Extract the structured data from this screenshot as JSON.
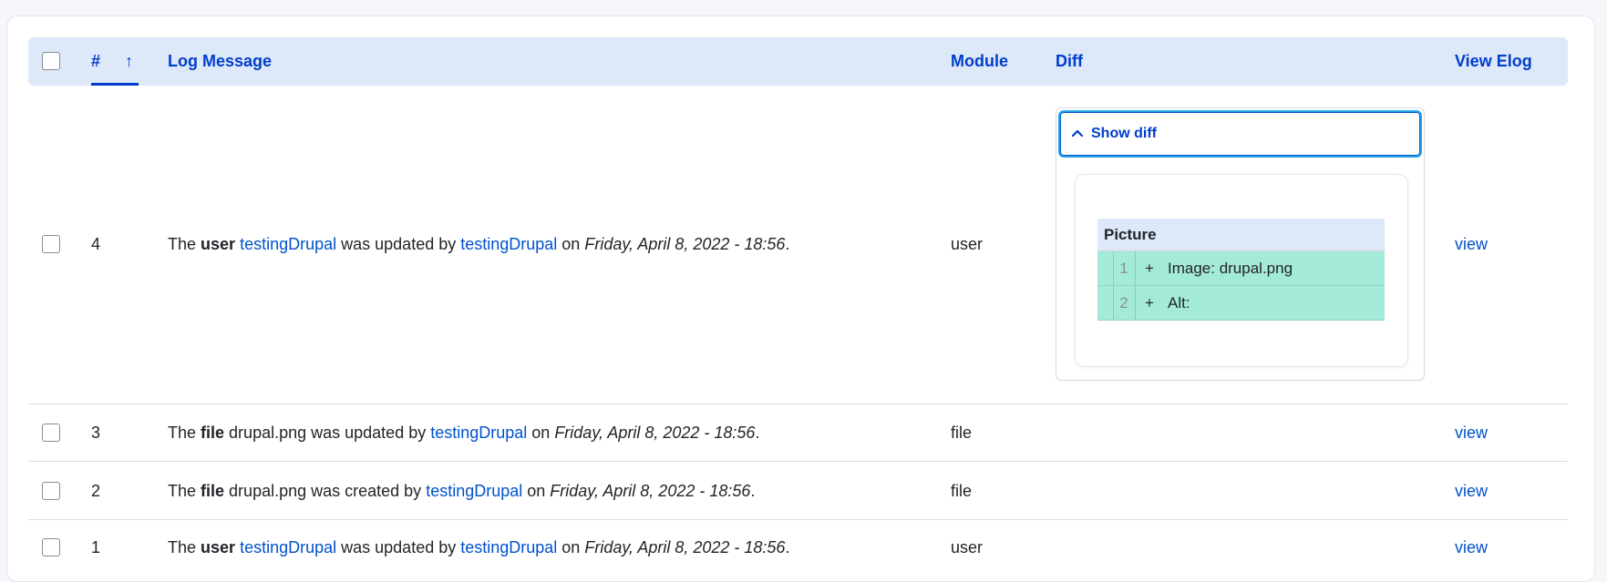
{
  "table": {
    "headers": {
      "number": "#",
      "sort_arrow": "↑",
      "log_message": "Log Message",
      "module": "Module",
      "diff": "Diff",
      "view_elog": "View Elog"
    },
    "rows": [
      {
        "number": "4",
        "msg_prefix": "The ",
        "msg_type": "user",
        "msg_subject_link": "testingDrupal",
        "msg_subject_text": "",
        "msg_action": " was updated by ",
        "msg_user_link": "testingDrupal",
        "msg_on": " on ",
        "msg_date": "Friday, April 8, 2022 - 18:56",
        "msg_end": ".",
        "module": "user",
        "view_link": "view"
      },
      {
        "number": "3",
        "msg_prefix": "The ",
        "msg_type": "file",
        "msg_subject_text": " drupal.png",
        "msg_action": " was updated by ",
        "msg_user_link": "testingDrupal",
        "msg_on": " on ",
        "msg_date": "Friday, April 8, 2022 - 18:56",
        "msg_end": ".",
        "module": "file",
        "view_link": "view"
      },
      {
        "number": "2",
        "msg_prefix": "The ",
        "msg_type": "file",
        "msg_subject_text": " drupal.png",
        "msg_action": " was created by ",
        "msg_user_link": "testingDrupal",
        "msg_on": " on ",
        "msg_date": "Friday, April 8, 2022 - 18:56",
        "msg_end": ".",
        "module": "file",
        "view_link": "view"
      },
      {
        "number": "1",
        "msg_prefix": "The ",
        "msg_type": "user",
        "msg_subject_link": "testingDrupal",
        "msg_action": " was updated by ",
        "msg_user_link": "testingDrupal",
        "msg_on": " on ",
        "msg_date": "Friday, April 8, 2022 - 18:56",
        "msg_end": ".",
        "module": "user",
        "view_link": "view"
      }
    ]
  },
  "diff": {
    "toggle_label": "Show diff",
    "toggle_icon": "chevron-up-icon",
    "field_name": "Picture",
    "lines": [
      {
        "line": "1",
        "sign": "+",
        "text": "Image: drupal.png"
      },
      {
        "line": "2",
        "sign": "+",
        "text": "Alt:"
      }
    ]
  },
  "colors": {
    "accent": "#003ecc",
    "link": "#0052cc",
    "header_bg": "#dde8f8",
    "diff_added_bg": "#a3ead8",
    "focus_ring": "#26a5e6"
  }
}
